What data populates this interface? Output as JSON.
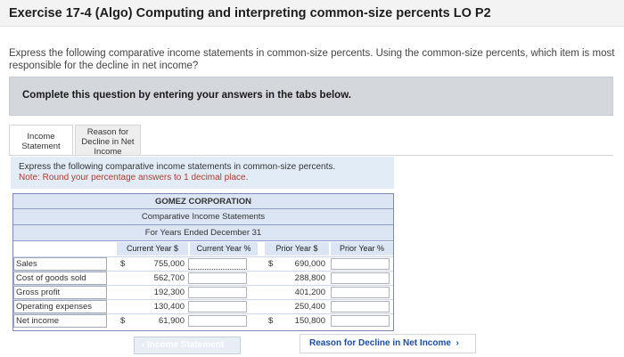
{
  "title": "Exercise 17-4 (Algo) Computing and interpreting common-size percents LO P2",
  "intro": "Express the following comparative income statements in common-size percents. Using the common-size percents, which item is most responsible for the decline in net income?",
  "complete": "Complete this question by entering your answers in the tabs below.",
  "tabs": [
    {
      "label": "Income\nStatement"
    },
    {
      "label": "Reason for\nDecline in Net\nIncome"
    }
  ],
  "instruction": {
    "line1": "Express the following comparative income statements in common-size percents.",
    "note": "Note: Round your percentage answers to 1 decimal place."
  },
  "statement": {
    "company": "GOMEZ CORPORATION",
    "name": "Comparative Income Statements",
    "period": "For Years Ended December 31",
    "headers": [
      "Current Year $",
      "Current Year %",
      "Prior Year $",
      "Prior Year %"
    ],
    "rows": [
      {
        "label": "Sales",
        "cur_sign": "$",
        "cur": "755,000",
        "prior_sign": "$",
        "prior": "690,000"
      },
      {
        "label": "Cost of goods sold",
        "cur_sign": "",
        "cur": "562,700",
        "prior_sign": "",
        "prior": "288,800"
      },
      {
        "label": "Gross profit",
        "cur_sign": "",
        "cur": "192,300",
        "prior_sign": "",
        "prior": "401,200"
      },
      {
        "label": "Operating expenses",
        "cur_sign": "",
        "cur": "130,400",
        "prior_sign": "",
        "prior": "250,400"
      },
      {
        "label": "Net income",
        "cur_sign": "$",
        "cur": "61,900",
        "prior_sign": "$",
        "prior": "150,800"
      }
    ]
  },
  "nav": {
    "prev": "Income Statement",
    "next": "Reason for Decline in Net Income"
  }
}
